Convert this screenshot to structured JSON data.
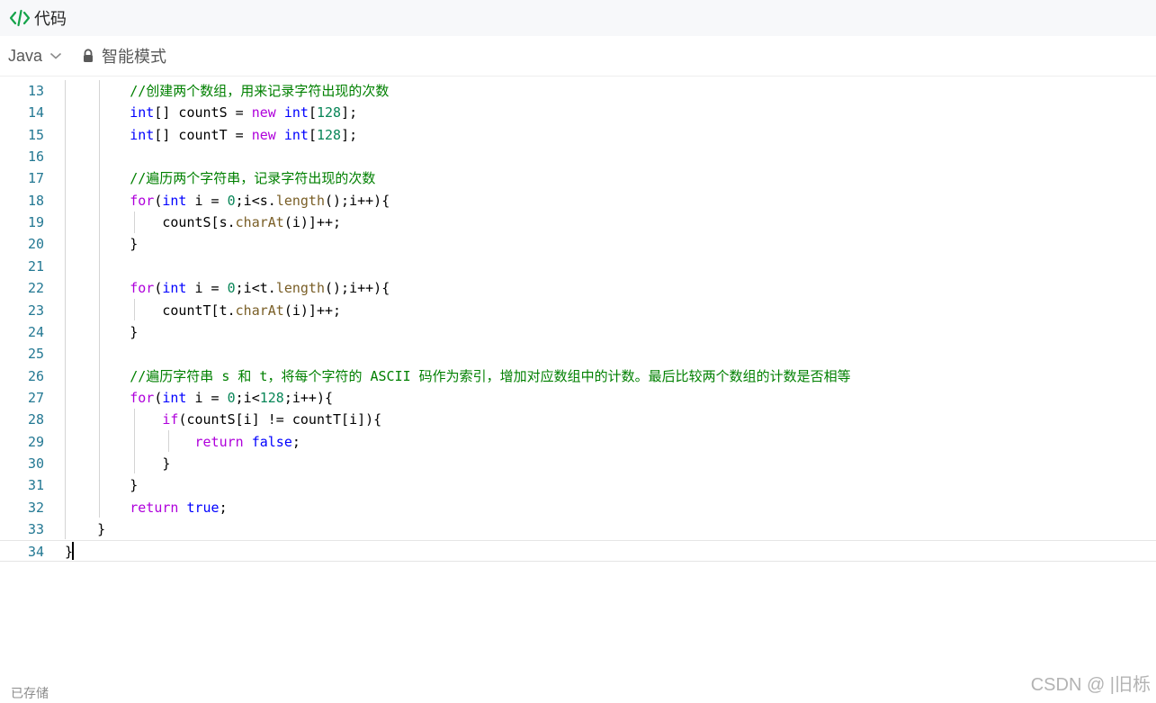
{
  "header": {
    "title": "代码",
    "icon": "code-icon"
  },
  "toolbar": {
    "language": "Java",
    "mode_label": "智能模式",
    "icons": [
      "chevron-down-icon",
      "lock-icon"
    ]
  },
  "colors": {
    "line_number": "#237893",
    "keyword": "#af00db",
    "type": "#0000ff",
    "number": "#098658",
    "comment": "#008000",
    "function": "#795e26",
    "icon_green": "#15a34a"
  },
  "editor": {
    "lines": [
      {
        "n": "13",
        "tokens": [
          [
            "",
            "        "
          ],
          [
            "cm",
            "//创建两个数组，用来记录字符出现的次数"
          ]
        ]
      },
      {
        "n": "14",
        "tokens": [
          [
            "",
            "        "
          ],
          [
            "ty",
            "int"
          ],
          [
            "",
            "[] countS = "
          ],
          [
            "kw",
            "new"
          ],
          [
            "",
            " "
          ],
          [
            "ty",
            "int"
          ],
          [
            "",
            "["
          ],
          [
            "num",
            "128"
          ],
          [
            "",
            "];"
          ]
        ]
      },
      {
        "n": "15",
        "tokens": [
          [
            "",
            "        "
          ],
          [
            "ty",
            "int"
          ],
          [
            "",
            "[] countT = "
          ],
          [
            "kw",
            "new"
          ],
          [
            "",
            " "
          ],
          [
            "ty",
            "int"
          ],
          [
            "",
            "["
          ],
          [
            "num",
            "128"
          ],
          [
            "",
            "];"
          ]
        ]
      },
      {
        "n": "16",
        "tokens": []
      },
      {
        "n": "17",
        "tokens": [
          [
            "",
            "        "
          ],
          [
            "cm",
            "//遍历两个字符串，记录字符出现的次数"
          ]
        ]
      },
      {
        "n": "18",
        "tokens": [
          [
            "",
            "        "
          ],
          [
            "kw",
            "for"
          ],
          [
            "",
            "("
          ],
          [
            "ty",
            "int"
          ],
          [
            "",
            " i = "
          ],
          [
            "num",
            "0"
          ],
          [
            "",
            ";i<s."
          ],
          [
            "fn",
            "length"
          ],
          [
            "",
            "();i++){"
          ]
        ]
      },
      {
        "n": "19",
        "tokens": [
          [
            "",
            "            countS[s."
          ],
          [
            "fn",
            "charAt"
          ],
          [
            "",
            "(i)]++;"
          ]
        ]
      },
      {
        "n": "20",
        "tokens": [
          [
            "",
            "        }"
          ]
        ]
      },
      {
        "n": "21",
        "tokens": []
      },
      {
        "n": "22",
        "tokens": [
          [
            "",
            "        "
          ],
          [
            "kw",
            "for"
          ],
          [
            "",
            "("
          ],
          [
            "ty",
            "int"
          ],
          [
            "",
            " i = "
          ],
          [
            "num",
            "0"
          ],
          [
            "",
            ";i<t."
          ],
          [
            "fn",
            "length"
          ],
          [
            "",
            "();i++){"
          ]
        ]
      },
      {
        "n": "23",
        "tokens": [
          [
            "",
            "            countT[t."
          ],
          [
            "fn",
            "charAt"
          ],
          [
            "",
            "(i)]++;"
          ]
        ]
      },
      {
        "n": "24",
        "tokens": [
          [
            "",
            "        }"
          ]
        ]
      },
      {
        "n": "25",
        "tokens": []
      },
      {
        "n": "26",
        "tokens": [
          [
            "",
            "        "
          ],
          [
            "cm",
            "//遍历字符串 s 和 t，将每个字符的 ASCII 码作为索引，增加对应数组中的计数。最后比较两个数组的计数是否相等"
          ]
        ]
      },
      {
        "n": "27",
        "tokens": [
          [
            "",
            "        "
          ],
          [
            "kw",
            "for"
          ],
          [
            "",
            "("
          ],
          [
            "ty",
            "int"
          ],
          [
            "",
            " i = "
          ],
          [
            "num",
            "0"
          ],
          [
            "",
            ";i<"
          ],
          [
            "num",
            "128"
          ],
          [
            "",
            ";i++){"
          ]
        ]
      },
      {
        "n": "28",
        "tokens": [
          [
            "",
            "            "
          ],
          [
            "kw",
            "if"
          ],
          [
            "",
            "(countS[i] != countT[i]){"
          ]
        ]
      },
      {
        "n": "29",
        "tokens": [
          [
            "",
            "                "
          ],
          [
            "kw",
            "return"
          ],
          [
            "",
            " "
          ],
          [
            "ty",
            "false"
          ],
          [
            "",
            ";"
          ]
        ]
      },
      {
        "n": "30",
        "tokens": [
          [
            "",
            "            }"
          ]
        ]
      },
      {
        "n": "31",
        "tokens": [
          [
            "",
            "        }"
          ]
        ]
      },
      {
        "n": "32",
        "tokens": [
          [
            "",
            "        "
          ],
          [
            "kw",
            "return"
          ],
          [
            "",
            " "
          ],
          [
            "ty",
            "true"
          ],
          [
            "",
            ";"
          ]
        ]
      },
      {
        "n": "33",
        "tokens": [
          [
            "",
            "    }"
          ]
        ]
      },
      {
        "n": "34",
        "tokens": [
          [
            "",
            "}"
          ]
        ],
        "current": true
      }
    ]
  },
  "status": {
    "text": "已存储"
  },
  "watermark": {
    "text": "CSDN @ |旧栎"
  }
}
